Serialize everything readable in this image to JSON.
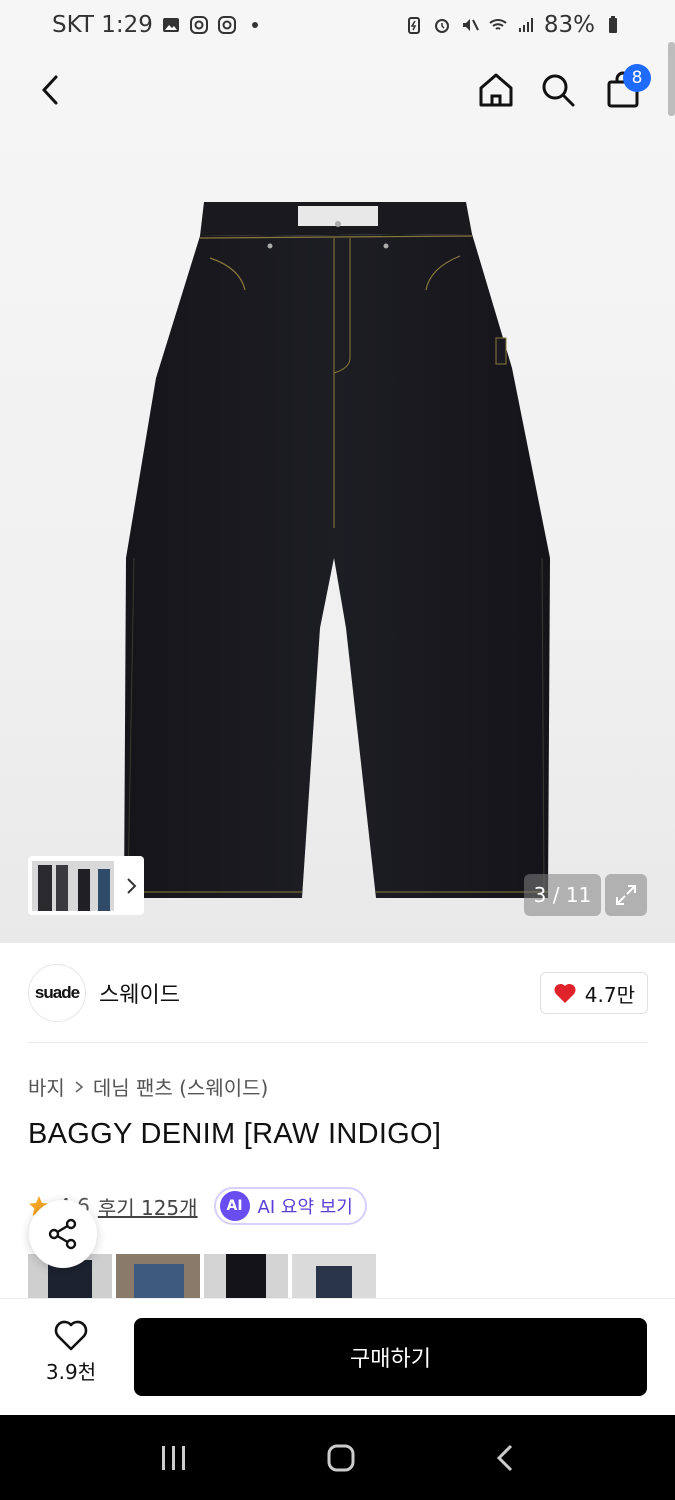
{
  "status_bar": {
    "carrier_time": "SKT 1:29",
    "battery": "83%",
    "left_icons": [
      "gallery-icon",
      "instagram-icon",
      "instagram-icon",
      "dot-icon"
    ],
    "right_icons": [
      "battery-saver-icon",
      "alarm-icon",
      "mute-icon",
      "wifi-icon",
      "signal-icon",
      "battery-icon"
    ]
  },
  "nav": {
    "back_icon": "chevron-left-icon",
    "home_icon": "home-icon",
    "search_icon": "search-icon",
    "cart_icon": "shopping-bag-icon",
    "cart_count": "8"
  },
  "gallery": {
    "counter": "3 / 11",
    "current": 3,
    "total": 11
  },
  "brand": {
    "logo_text": "suade",
    "name": "스웨이드",
    "likes": "4.7만"
  },
  "breadcrumb": {
    "category": "바지",
    "subcategory": "데님 팬츠 (스웨이드)"
  },
  "product": {
    "title": "BAGGY DENIM [RAW INDIGO]",
    "rating": "4.6",
    "reviews": "후기 125개",
    "ai_badge": "AI",
    "ai_summary": "AI 요약 보기"
  },
  "bottom_bar": {
    "wish_count": "3.9천",
    "buy_label": "구매하기"
  },
  "colors": {
    "accent_blue": "#1f6bff",
    "heart_red": "#e0222a",
    "ai_purple": "#6a4df0",
    "buy_black": "#000000"
  }
}
